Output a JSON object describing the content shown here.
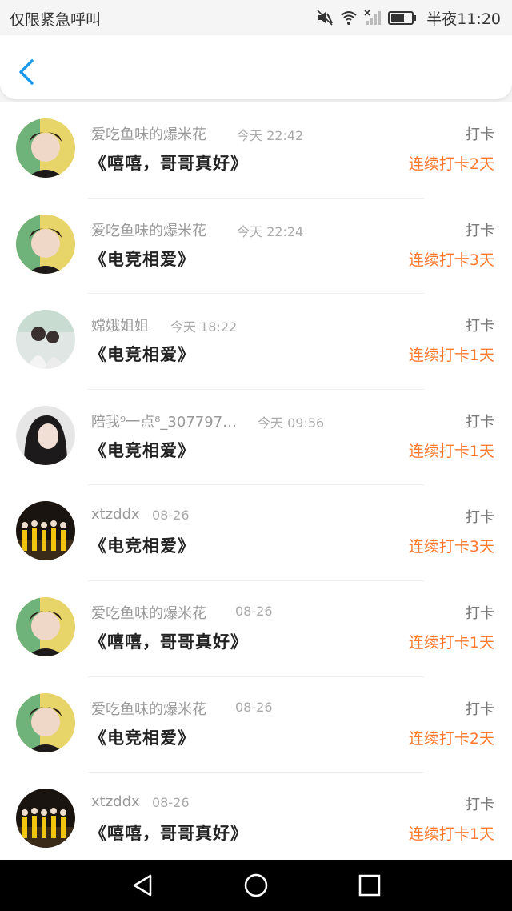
{
  "status_bar": {
    "carrier": "仅限紧急呼叫",
    "time": "半夜11:20",
    "icons": [
      "mute-icon",
      "wifi-icon",
      "signal-icon",
      "battery-icon"
    ]
  },
  "header": {
    "back_icon": "chevron-left-icon",
    "accent_color": "#1a9bf0"
  },
  "list": {
    "highlight_color": "#ff7a2e",
    "items": [
      {
        "username": "爱吃鱼味的爆米花",
        "time": "今天 22:42",
        "title": "《嘻嘻，哥哥真好》",
        "type": "打卡",
        "streak": "连续打卡2天"
      },
      {
        "username": "爱吃鱼味的爆米花",
        "time": "今天 22:24",
        "title": "《电竞相爱》",
        "type": "打卡",
        "streak": "连续打卡3天"
      },
      {
        "username": "嫦娥姐姐",
        "time": "今天 18:22",
        "title": "《电竞相爱》",
        "type": "打卡",
        "streak": "连续打卡1天"
      },
      {
        "username": "陪我⁹一点⁸_307797…",
        "time": "今天 09:56",
        "title": "《电竞相爱》",
        "type": "打卡",
        "streak": "连续打卡1天"
      },
      {
        "username": "xtzddx",
        "time": "08-26",
        "title": "《电竞相爱》",
        "type": "打卡",
        "streak": "连续打卡3天"
      },
      {
        "username": "爱吃鱼味的爆米花",
        "time": "08-26",
        "title": "《嘻嘻，哥哥真好》",
        "type": "打卡",
        "streak": "连续打卡1天"
      },
      {
        "username": "爱吃鱼味的爆米花",
        "time": "08-26",
        "title": "《电竞相爱》",
        "type": "打卡",
        "streak": "连续打卡2天"
      },
      {
        "username": "xtzddx",
        "time": "08-26",
        "title": "《嘻嘻，哥哥真好》",
        "type": "打卡",
        "streak": "连续打卡1天"
      }
    ]
  },
  "nav_bar": {
    "icons": [
      "back-triangle-icon",
      "home-circle-icon",
      "recents-square-icon"
    ]
  }
}
